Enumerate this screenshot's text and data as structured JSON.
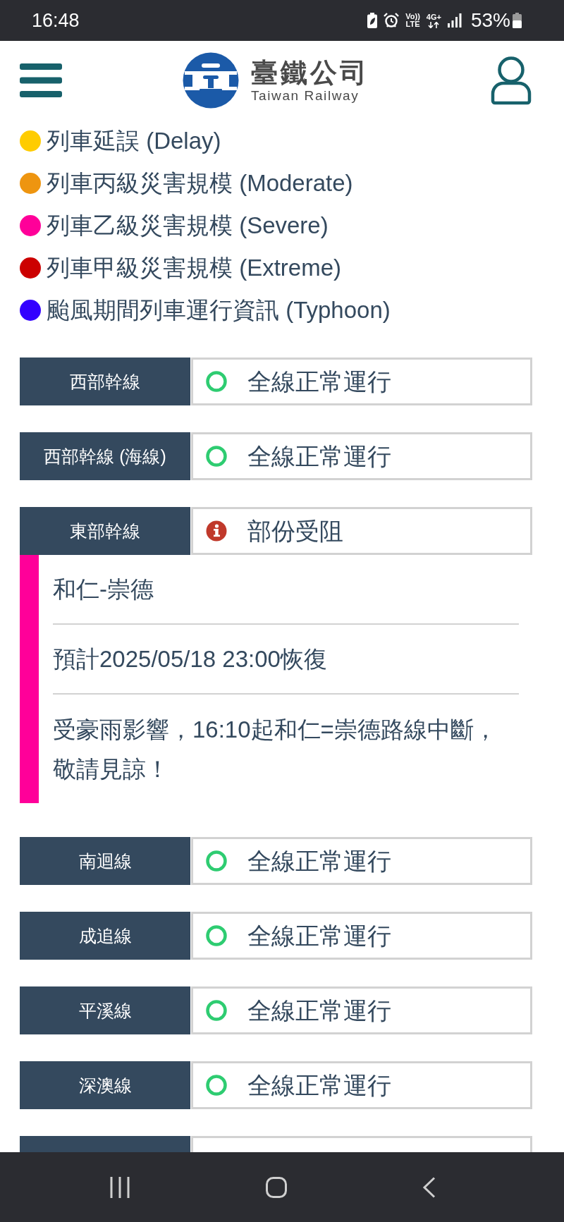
{
  "status_bar": {
    "time": "16:48",
    "volte_top": "Vo))",
    "volte_bottom": "LTE",
    "network": "4G+",
    "battery": "53%"
  },
  "header": {
    "brand_title": "臺鐵公司",
    "brand_subtitle": "Taiwan Railway"
  },
  "legend": [
    {
      "label": "列車延誤 (Delay)",
      "color": "#ffcc00"
    },
    {
      "label": "列車丙級災害規模 (Moderate)",
      "color": "#ee9510"
    },
    {
      "label": "列車乙級災害規模 (Severe)",
      "color": "#ff0099"
    },
    {
      "label": "列車甲級災害規模 (Extreme)",
      "color": "#cc0000"
    },
    {
      "label": "颱風期間列車運行資訊 (Typhoon)",
      "color": "#3300ff"
    }
  ],
  "lines": [
    {
      "name": "西部幹線",
      "kind": "normal",
      "status": "全線正常運行"
    },
    {
      "name": "西部幹線 (海線)",
      "kind": "normal",
      "status": "全線正常運行"
    },
    {
      "name": "東部幹線",
      "kind": "alert",
      "status": "部份受阻",
      "detail": {
        "color": "#ff0099",
        "section": "和仁-崇德",
        "estimate": "預計2025/05/18 23:00恢復",
        "message": "受豪雨影響，16:10起和仁=崇德路線中斷，敬請見諒！"
      }
    },
    {
      "name": "南迴線",
      "kind": "normal",
      "status": "全線正常運行"
    },
    {
      "name": "成追線",
      "kind": "normal",
      "status": "全線正常運行"
    },
    {
      "name": "平溪線",
      "kind": "normal",
      "status": "全線正常運行"
    },
    {
      "name": "深澳線",
      "kind": "normal",
      "status": "全線正常運行"
    }
  ],
  "more_lines_below": true
}
